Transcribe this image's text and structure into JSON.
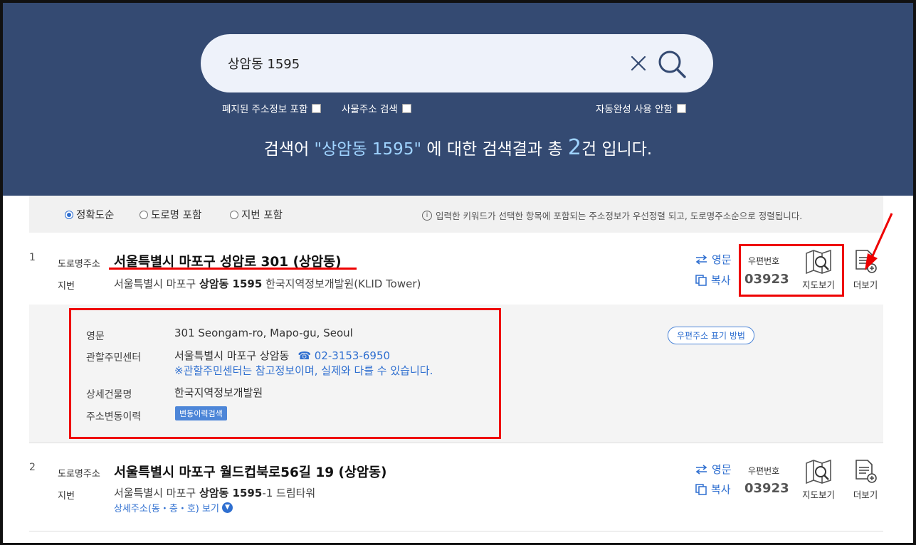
{
  "search": {
    "query": "상암동 1595",
    "placeholder": ""
  },
  "options": {
    "include_abolished": "폐지된 주소정보 포함",
    "thing_address": "사물주소 검색",
    "autocomplete_off": "자동완성 사용 안함"
  },
  "summary": {
    "prefix": "검색어 ",
    "query_quoted": "\"상암동 1595\"",
    "middle": " 에 대한 검색결과 총 ",
    "count": "2",
    "suffix": "건 입니다."
  },
  "sort": {
    "items": [
      {
        "label": "정확도순",
        "selected": true
      },
      {
        "label": "도로명 포함",
        "selected": false
      },
      {
        "label": "지번 포함",
        "selected": false
      }
    ],
    "info": "입력한 키워드가 선택한 항목에 포함되는 주소정보가 우선정렬 되고, 도로명주소순으로 정렬됩니다."
  },
  "labels": {
    "road_address": "도로명주소",
    "jibun": "지번",
    "english": "영문",
    "copy": "복사",
    "zip_label": "우편번호",
    "map_view": "지도보기",
    "more": "더보기"
  },
  "results": [
    {
      "index": "1",
      "road": "서울특별시 마포구 성암로 301 (상암동)",
      "jibun_pre": "서울특별시 마포구 ",
      "jibun_bold": "상암동 1595",
      "jibun_post": " 한국지역정보개발원(KLID Tower)",
      "zip": "03923"
    },
    {
      "index": "2",
      "road": "서울특별시 마포구 월드컵북로56길 19 (상암동)",
      "jibun_pre": "서울특별시 마포구 ",
      "jibun_bold": "상암동 1595",
      "jibun_post": "-1 드림타워",
      "zip": "03923",
      "detail_link": "상세주소(동・층・호) 보기"
    }
  ],
  "detail": {
    "english_label": "영문",
    "english_value": "301 Seongam-ro, Mapo-gu, Seoul",
    "center_label": "관할주민센터",
    "center_value": "서울특별시 마포구 상암동",
    "center_phone": "☎ 02-3153-6950",
    "center_note": "※관할주민센터는 참고정보이며, 실제와 다를 수 있습니다.",
    "building_label": "상세건물명",
    "building_value": "한국지역정보개발원",
    "history_label": "주소변동이력",
    "history_button": "변동이력검색",
    "zip_guide": "우편주소 표기 방법"
  },
  "colors": {
    "header_bg": "#344a72",
    "accent": "#2f6fd0",
    "highlight": "#9fd3ff",
    "annotation_red": "#e00000"
  }
}
